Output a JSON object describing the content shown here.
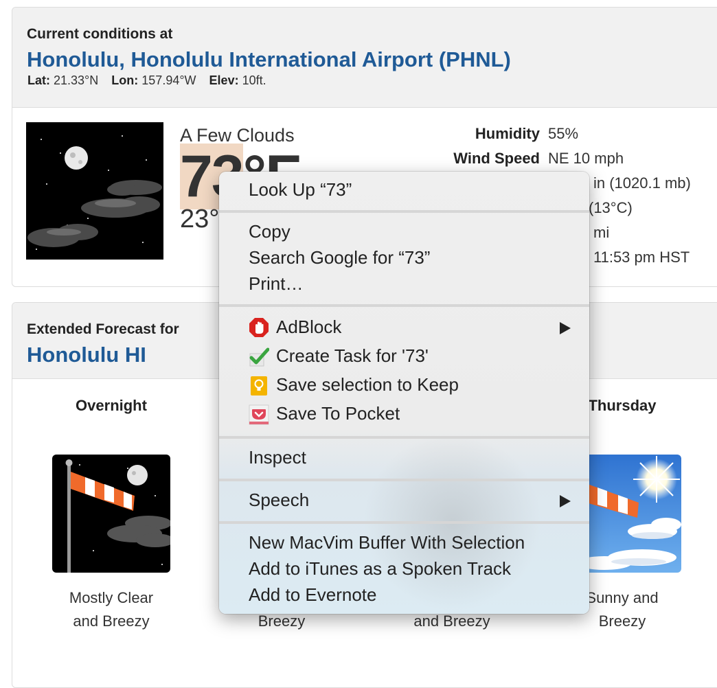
{
  "current": {
    "heading": "Current conditions at",
    "station": "Honolulu, Honolulu International Airport (PHNL)",
    "lat_label": "Lat:",
    "lat": "21.33°N",
    "lon_label": "Lon:",
    "lon": "157.94°W",
    "elev_label": "Elev:",
    "elev": "10ft.",
    "condition": "A Few Clouds",
    "temp_f_sel": "73",
    "temp_f_rest": "°F",
    "temp_c": "23°",
    "details": [
      {
        "label": "Humidity",
        "value": "55%"
      },
      {
        "label": "Wind Speed",
        "value": "NE 10 mph"
      }
    ],
    "detail_fragments": [
      "in (1020.1 mb)",
      "(13°C)",
      "mi",
      "11:53 pm HST"
    ]
  },
  "extended": {
    "heading": "Extended Forecast for",
    "location": "Honolulu HI",
    "periods": [
      {
        "name": "Overnight",
        "desc1": "Mostly Clear",
        "desc2": "and Breezy"
      },
      {
        "name": "",
        "desc1": "",
        "desc2": "Breezy"
      },
      {
        "name": "",
        "desc1": "",
        "desc2": "and Breezy"
      },
      {
        "name": "Thursday",
        "desc1": "Sunny and",
        "desc2": "Breezy"
      }
    ]
  },
  "context_menu": {
    "look_up": "Look Up “73”",
    "copy": "Copy",
    "search_google": "Search Google for “73”",
    "print": "Print…",
    "adblock": "AdBlock",
    "create_task": "Create Task for '73'",
    "save_keep": "Save selection to Keep",
    "save_pocket": "Save To Pocket",
    "inspect": "Inspect",
    "speech": "Speech",
    "macvim": "New MacVim Buffer With Selection",
    "itunes": "Add to iTunes as a Spoken Track",
    "evernote": "Add to Evernote"
  },
  "colors": {
    "link_blue": "#1f5a96",
    "selection": "#f1d8c3",
    "adblock_red": "#d9231f",
    "check_green": "#3aa540",
    "keep_yellow": "#f4b400",
    "pocket_red": "#e0455a"
  },
  "icons": [
    "night-clouds-icon",
    "windsock-night-icon",
    "windsock-sunny-icon",
    "adblock-icon",
    "checkmark-icon",
    "keep-bulb-icon",
    "pocket-icon",
    "submenu-arrow-icon"
  ]
}
